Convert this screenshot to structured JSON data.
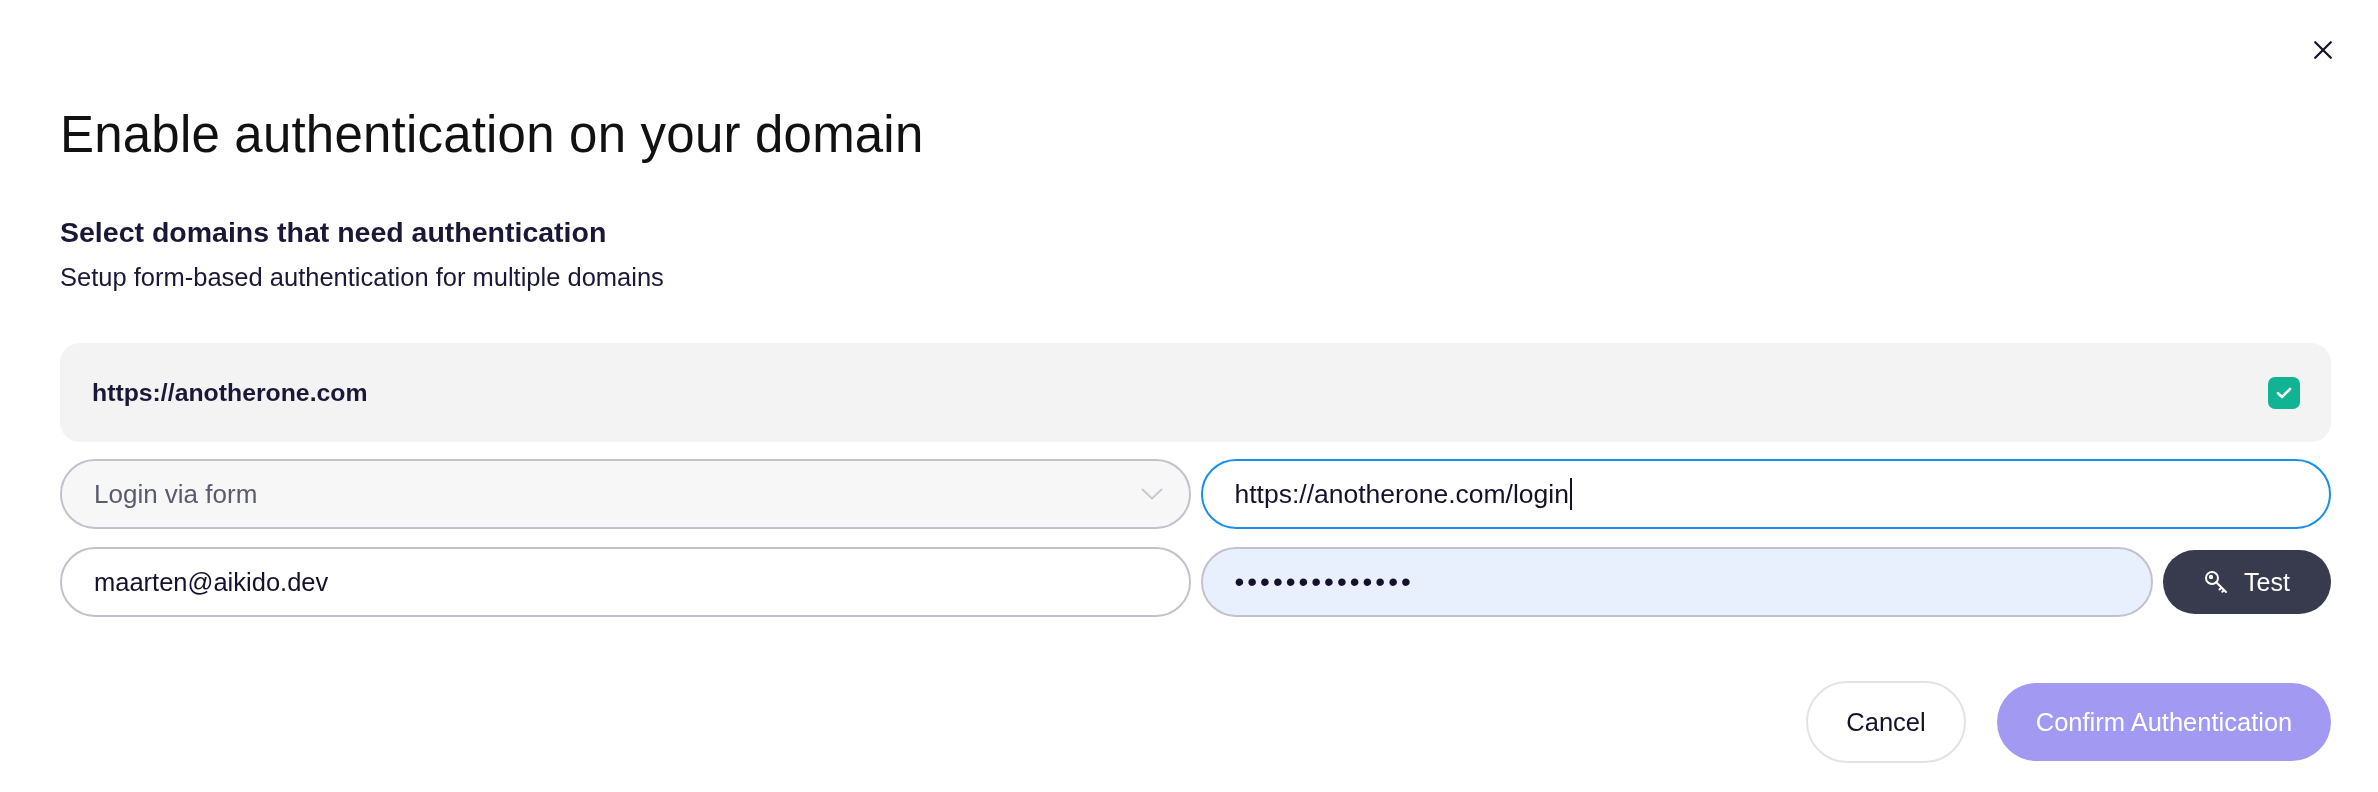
{
  "title": "Enable authentication on your domain",
  "section": {
    "heading": "Select domains that need authentication",
    "description": "Setup form-based authentication for multiple domains"
  },
  "domains": [
    {
      "url": "https://anotherone.com",
      "checked": true,
      "method": {
        "value": "Login via form",
        "disabled": true
      },
      "login_url": {
        "value": "https://anotherone.com/login",
        "focused": true
      },
      "username": {
        "value": "maarten@aikido.dev",
        "autofilled": false
      },
      "password": {
        "value": "••••••••••••••",
        "autofilled": true
      },
      "test_button": {
        "label": "Test"
      }
    }
  ],
  "buttons": [
    {
      "label": "Cancel",
      "kind": "secondary",
      "disabled": false
    },
    {
      "label": "Confirm Authentication",
      "kind": "primary",
      "disabled": true
    }
  ]
}
